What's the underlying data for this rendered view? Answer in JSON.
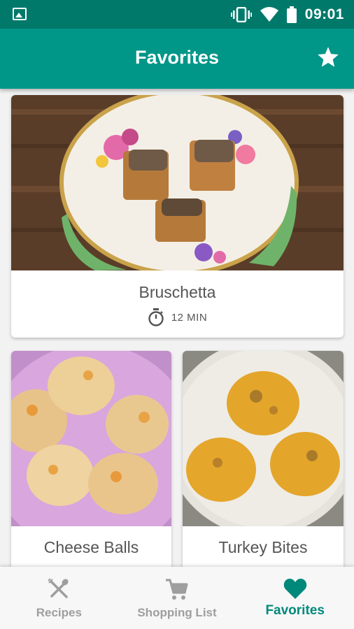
{
  "status_bar": {
    "time": "09:01"
  },
  "app_bar": {
    "title": "Favorites",
    "action_icon": "star-icon"
  },
  "recipes": [
    {
      "title": "Bruschetta",
      "time": "12 MIN"
    },
    {
      "title": "Cheese Balls",
      "time": ""
    },
    {
      "title": "Turkey Bites",
      "time": ""
    }
  ],
  "bottom_nav": {
    "items": [
      {
        "label": "Recipes",
        "icon": "fork-spoon-icon",
        "active": false
      },
      {
        "label": "Shopping List",
        "icon": "cart-icon",
        "active": false
      },
      {
        "label": "Favorites",
        "icon": "heart-icon",
        "active": true
      }
    ]
  },
  "colors": {
    "primary": "#009688",
    "primary_dark": "#00796b",
    "accent": "#00897b"
  }
}
